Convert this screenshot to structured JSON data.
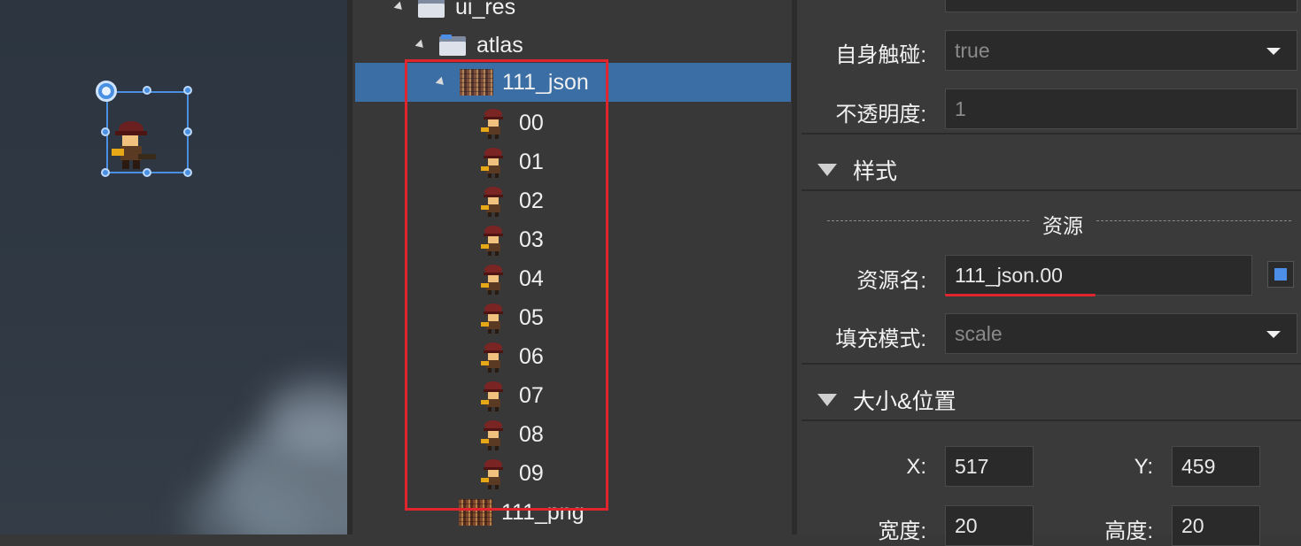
{
  "tree": {
    "items": [
      {
        "label": "ui_res",
        "kind": "folder",
        "level": 0
      },
      {
        "label": "atlas",
        "kind": "folder",
        "level": 1
      },
      {
        "label": "111_json",
        "kind": "atlas",
        "level": 2,
        "selected": true
      },
      {
        "label": "00",
        "kind": "sprite"
      },
      {
        "label": "01",
        "kind": "sprite"
      },
      {
        "label": "02",
        "kind": "sprite"
      },
      {
        "label": "03",
        "kind": "sprite"
      },
      {
        "label": "04",
        "kind": "sprite"
      },
      {
        "label": "05",
        "kind": "sprite"
      },
      {
        "label": "06",
        "kind": "sprite"
      },
      {
        "label": "07",
        "kind": "sprite"
      },
      {
        "label": "08",
        "kind": "sprite"
      },
      {
        "label": "09",
        "kind": "sprite"
      },
      {
        "label": "111_png",
        "kind": "atlas"
      }
    ]
  },
  "inspector": {
    "self_touch_label": "自身触碰:",
    "self_touch_value": "true",
    "opacity_label": "不透明度:",
    "opacity_value": "1",
    "style_section": "样式",
    "resource_divider": "资源",
    "resource_name_label": "资源名:",
    "resource_name_value": "111_json.00",
    "fill_mode_label": "填充模式:",
    "fill_mode_value": "scale",
    "size_pos_section": "大小&位置",
    "x_label": "X:",
    "x_value": "517",
    "y_label": "Y:",
    "y_value": "459",
    "width_label": "宽度:",
    "width_value": "20",
    "height_label": "高度:",
    "height_value": "20"
  },
  "colors": {
    "selection": "#3a6ea5",
    "highlight_box": "#e0252e",
    "gizmo": "#4a90e2"
  }
}
